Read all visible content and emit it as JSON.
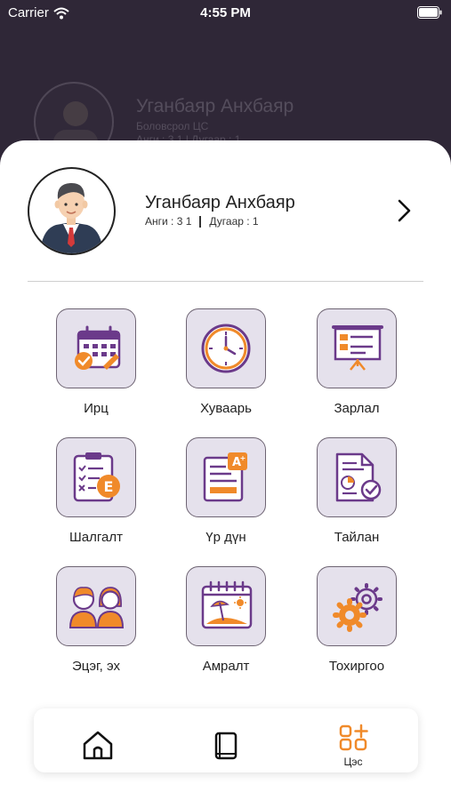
{
  "status_bar": {
    "carrier": "Carrier",
    "time": "4:55 PM"
  },
  "background_profile": {
    "name": "Уганбаяр Анхбаяр",
    "school": "Боловсрол ЦС",
    "class_line": "Анги : 3 1   |   Дугаар : 1"
  },
  "profile": {
    "name": "Уганбаяр Анхбаяр",
    "class_label": "Анги : 3 1",
    "number_label": "Дугаар : 1"
  },
  "menu": [
    {
      "label": "Ирц",
      "icon": "attendance-calendar-icon"
    },
    {
      "label": "Хуваарь",
      "icon": "schedule-clock-icon"
    },
    {
      "label": "Зарлал",
      "icon": "announcement-board-icon"
    },
    {
      "label": "Шалгалт",
      "icon": "exam-clipboard-icon"
    },
    {
      "label": "Үр дүн",
      "icon": "results-document-icon"
    },
    {
      "label": "Тайлан",
      "icon": "report-document-icon"
    },
    {
      "label": "Эцэг, эх",
      "icon": "parents-icon"
    },
    {
      "label": "Амралт",
      "icon": "vacation-calendar-icon"
    },
    {
      "label": "Тохиргоо",
      "icon": "settings-gears-icon"
    }
  ],
  "tabbar": {
    "home_icon": "home-icon",
    "book_icon": "book-icon",
    "menu_icon": "grid-plus-icon",
    "menu_label": "Цэс"
  },
  "colors": {
    "header_bg": "#2f2737",
    "tile_bg": "#e5e1ec",
    "icon_purple": "#6b3a8a",
    "icon_orange": "#f08a2a"
  }
}
